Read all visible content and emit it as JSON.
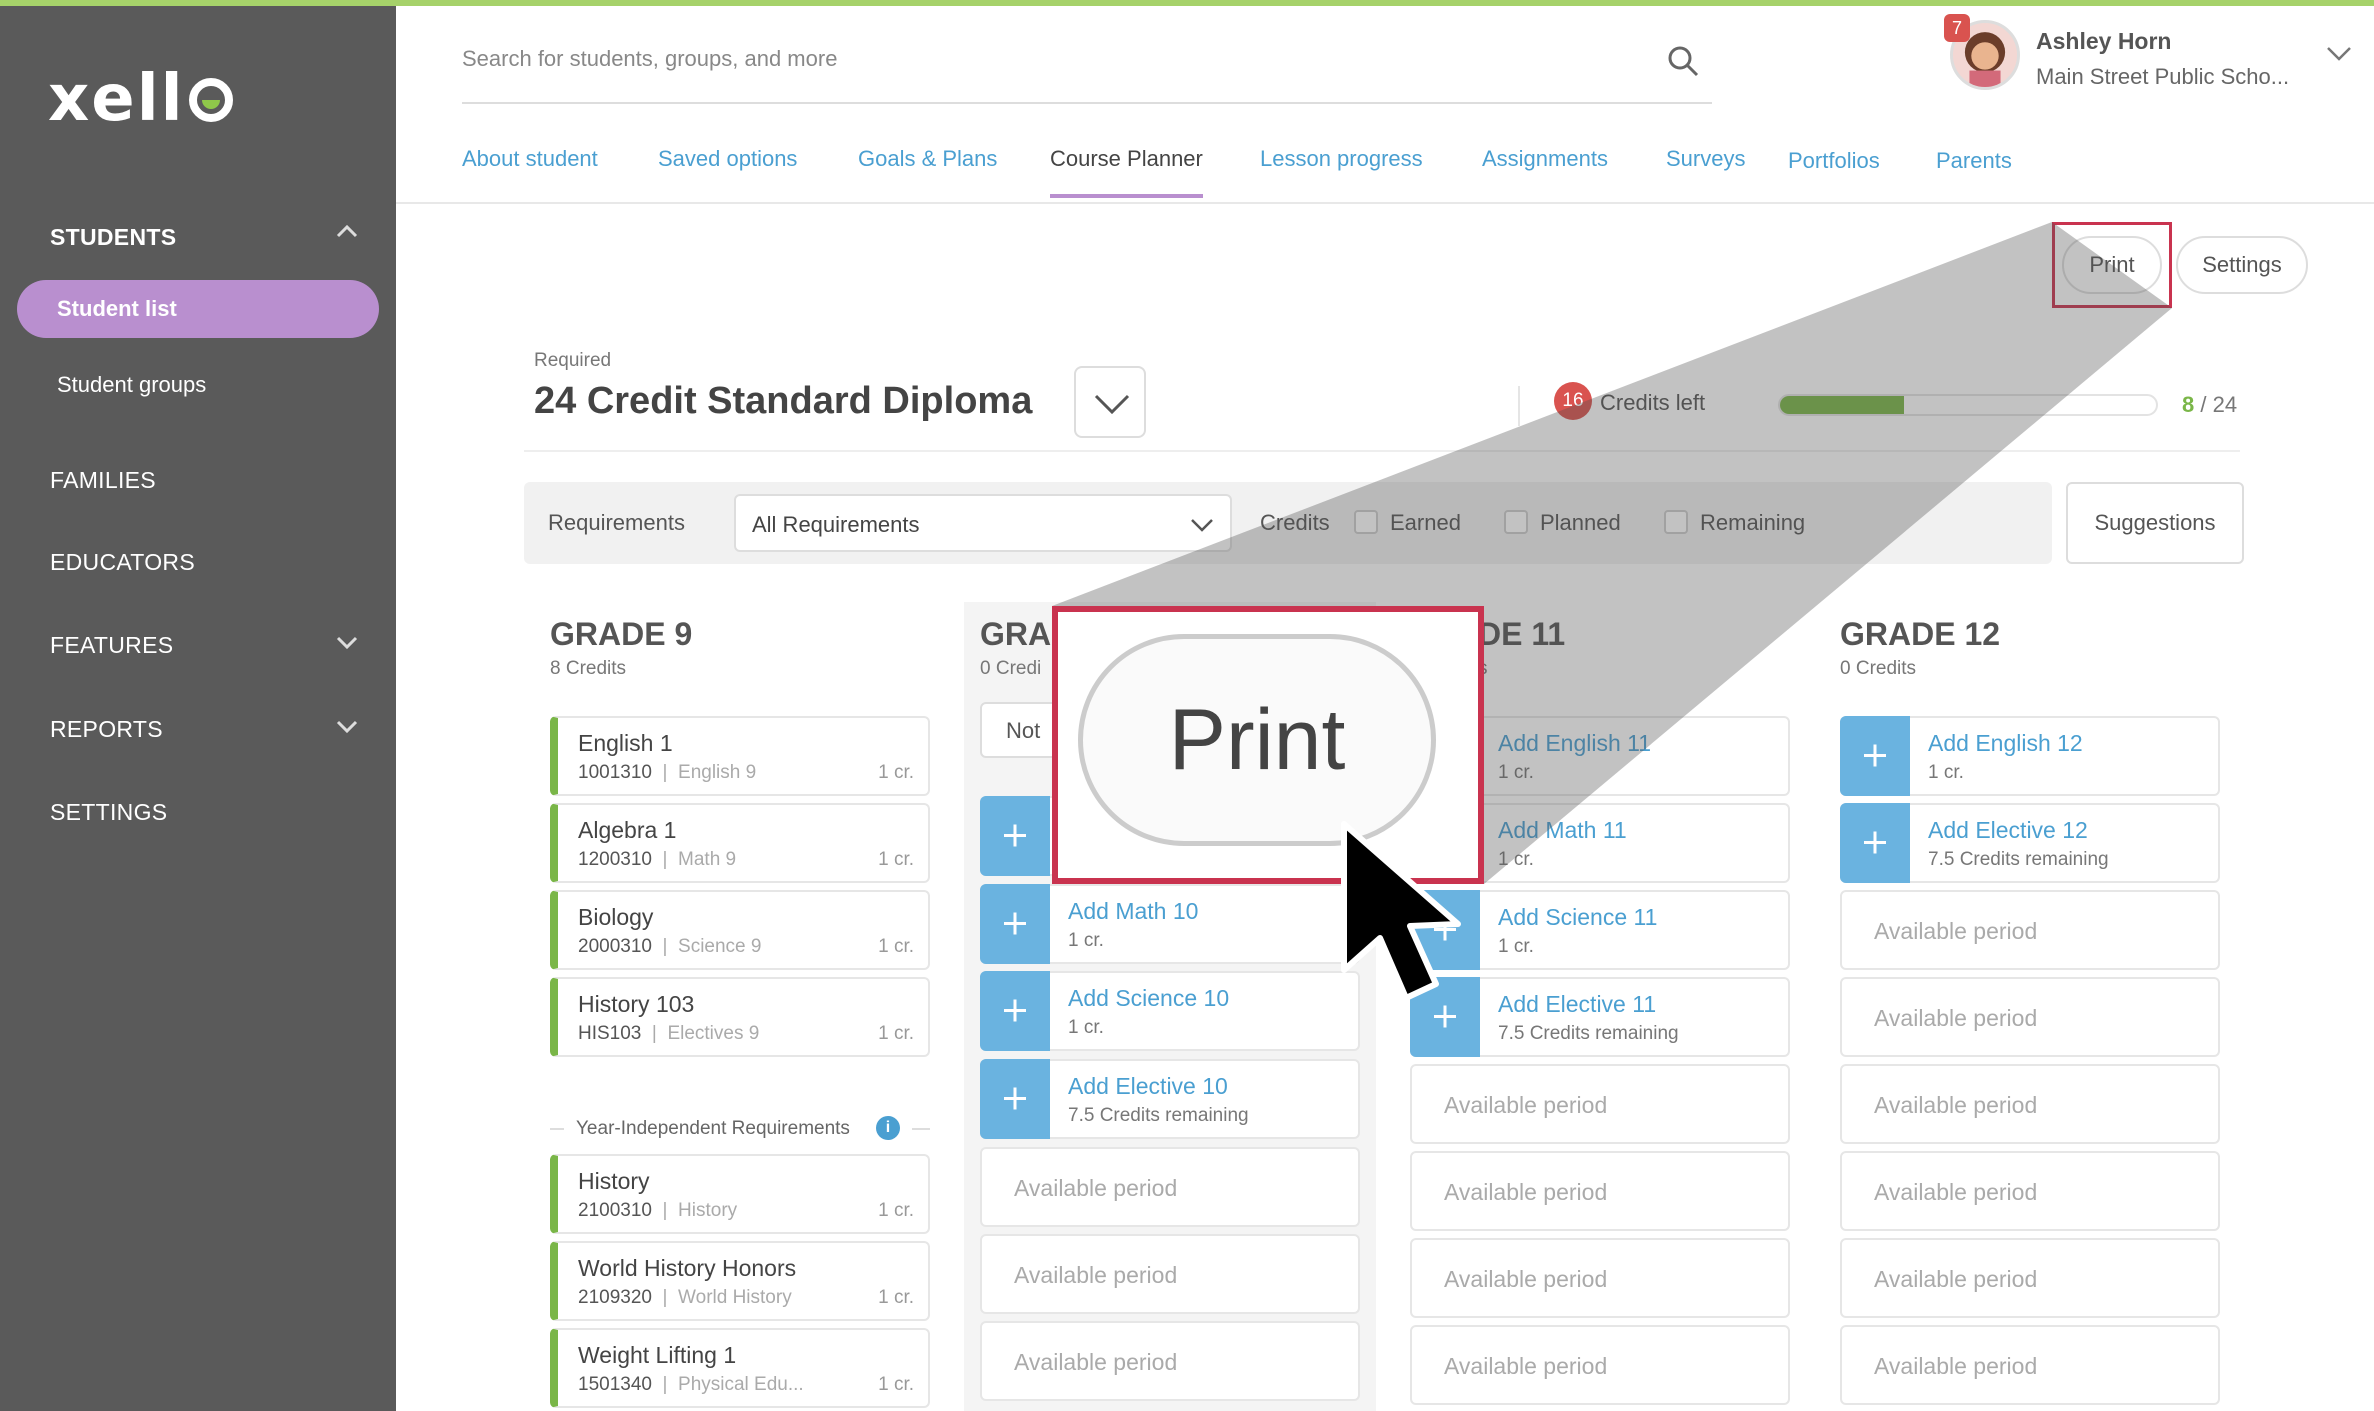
{
  "app": {
    "logo": "xello"
  },
  "sidebar": {
    "students": "STUDENTS",
    "student_list": "Student list",
    "student_groups": "Student groups",
    "families": "FAMILIES",
    "educators": "EDUCATORS",
    "features": "FEATURES",
    "reports": "REPORTS",
    "settings": "SETTINGS"
  },
  "search": {
    "placeholder": "Search for students, groups, and more"
  },
  "user": {
    "name": "Ashley Horn",
    "school": "Main Street Public Scho...",
    "notifications": "7"
  },
  "tabs": [
    "About student",
    "Saved options",
    "Goals & Plans",
    "Course Planner",
    "Lesson progress",
    "Assignments",
    "Surveys",
    "Portfolios",
    "Parents"
  ],
  "actions": {
    "print": "Print",
    "settings": "Settings",
    "zoom_print": "Print"
  },
  "diploma": {
    "label": "Required",
    "name": "24 Credit Standard Diploma",
    "credits_left": "16",
    "credits_left_label": "Credits left",
    "earned": "8",
    "total": "/ 24",
    "progress": 0.33
  },
  "filters": {
    "requirements_label": "Requirements",
    "requirements_value": "All Requirements",
    "credits_label": "Credits",
    "earned": "Earned",
    "planned": "Planned",
    "remaining": "Remaining",
    "suggestions": "Suggestions"
  },
  "grade9": {
    "title": "GRADE 9",
    "credits": "8 Credits",
    "courses": [
      {
        "name": "English 1",
        "code": "1001310",
        "cat": "English 9",
        "cr": "1 cr."
      },
      {
        "name": "Algebra 1",
        "code": "1200310",
        "cat": "Math 9",
        "cr": "1 cr."
      },
      {
        "name": "Biology",
        "code": "2000310",
        "cat": "Science 9",
        "cr": "1 cr."
      },
      {
        "name": "History 103",
        "code": "HIS103",
        "cat": "Electives 9",
        "cr": "1 cr."
      }
    ],
    "year_independent": "Year-Independent Requirements",
    "yi_courses": [
      {
        "name": "History",
        "code": "2100310",
        "cat": "History",
        "cr": "1 cr."
      },
      {
        "name": "World History Honors",
        "code": "2109320",
        "cat": "World History",
        "cr": "1 cr."
      },
      {
        "name": "Weight Lifting 1",
        "code": "1501340",
        "cat": "Physical Edu...",
        "cr": "1 cr."
      }
    ]
  },
  "grade10": {
    "title": "GRA",
    "credits": "0 Credi",
    "not_btn": "Not",
    "add": [
      {
        "name": "Add Math 10",
        "sub": "1 cr."
      },
      {
        "name": "Add Science 10",
        "sub": "1 cr."
      },
      {
        "name": "Add Elective 10",
        "sub": "7.5 Credits remaining"
      }
    ],
    "available": [
      "Available period",
      "Available period",
      "Available period"
    ]
  },
  "grade11": {
    "title": "DE 11",
    "credits": "s",
    "add": [
      {
        "name": "Add English 11",
        "sub": "1 cr."
      },
      {
        "name": "Add Math 11",
        "sub": "1 cr."
      },
      {
        "name": "Add Science 11",
        "sub": "1 cr."
      },
      {
        "name": "Add Elective 11",
        "sub": "7.5 Credits remaining"
      }
    ],
    "available": [
      "Available period",
      "Available period",
      "Available period",
      "Available period"
    ]
  },
  "grade12": {
    "title": "GRADE 12",
    "credits": "0 Credits",
    "add": [
      {
        "name": "Add English 12",
        "sub": "1 cr."
      },
      {
        "name": "Add Elective 12",
        "sub": "7.5 Credits remaining"
      }
    ],
    "available": [
      "Available period",
      "Available period",
      "Available period",
      "Available period",
      "Available period",
      "Available period"
    ]
  },
  "colors": {
    "accent": "#b98fcf",
    "link": "#4a9fd1",
    "success": "#7ab648",
    "alert": "#d9534f",
    "highlight": "#c9334f"
  }
}
